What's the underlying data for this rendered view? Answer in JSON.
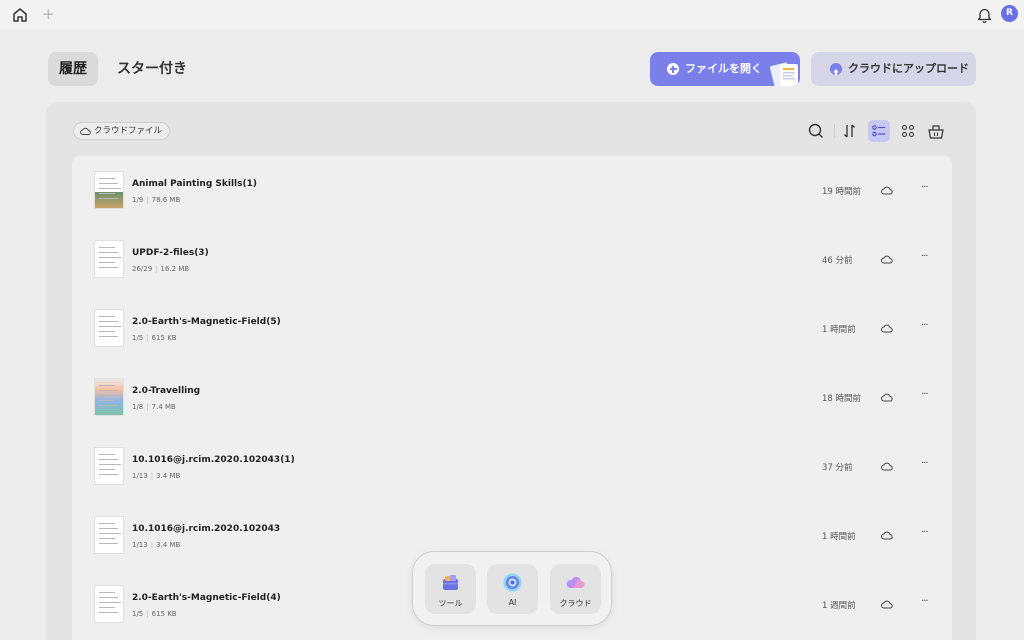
{
  "header": {
    "avatar_initial": "R",
    "tabs": [
      {
        "label": "履歴",
        "active": true
      },
      {
        "label": "スター付き",
        "active": false
      }
    ],
    "open_button_label": "ファイルを開く",
    "upload_button_label": "クラウドにアップロード"
  },
  "toolbar": {
    "cloud_files_label": "クラウドファイル",
    "icons": [
      "search-icon",
      "sort-icon",
      "list-view-icon",
      "grid-view-icon",
      "basket-icon"
    ]
  },
  "files": [
    {
      "name": "Animal Painting Skills(1)",
      "pages": "1/9",
      "size": "78.6 MB",
      "time": "19 時間前"
    },
    {
      "name": "UPDF-2-files(3)",
      "pages": "26/29",
      "size": "16.2 MB",
      "time": "46 分前"
    },
    {
      "name": "2.0-Earth's-Magnetic-Field(5)",
      "pages": "1/5",
      "size": "615 KB",
      "time": "1 時間前"
    },
    {
      "name": "2.0-Travelling",
      "pages": "1/8",
      "size": "7.4 MB",
      "time": "18 時間前"
    },
    {
      "name": "10.1016@j.rcim.2020.102043(1)",
      "pages": "1/13",
      "size": "3.4 MB",
      "time": "37 分前"
    },
    {
      "name": "10.1016@j.rcim.2020.102043",
      "pages": "1/13",
      "size": "3.4 MB",
      "time": "1 時間前"
    },
    {
      "name": "2.0-Earth's-Magnetic-Field(4)",
      "pages": "1/5",
      "size": "615 KB",
      "time": "1 週間前"
    }
  ],
  "dock": [
    {
      "label": "ツール",
      "icon": "tools-icon"
    },
    {
      "label": "AI",
      "icon": "ai-icon"
    },
    {
      "label": "クラウド",
      "icon": "cloud-icon"
    }
  ],
  "colors": {
    "accent": "#7b7fe9",
    "upload_bg": "#d6d6e8",
    "active_view": "#c7c8f1"
  }
}
